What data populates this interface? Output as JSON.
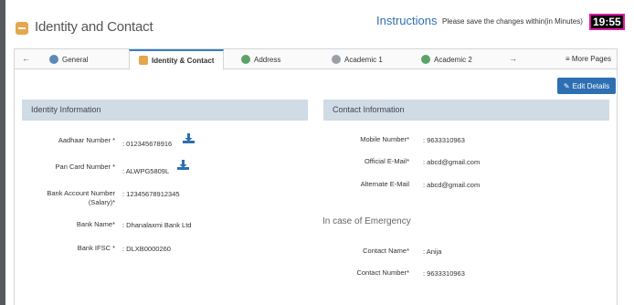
{
  "header": {
    "title": "Identity and Contact",
    "instructions": "Instructions",
    "save_note": "Please save the changes within(in Minutes)",
    "timer": "19:55"
  },
  "tabs": [
    {
      "label": "General",
      "icon": "user-icon"
    },
    {
      "label": "Identity & Contact",
      "icon": "id-card-icon",
      "active": true
    },
    {
      "label": "Address",
      "icon": "address-icon"
    },
    {
      "label": "Academic 1",
      "icon": "academic-icon"
    },
    {
      "label": "Academic 2",
      "icon": "academic-icon"
    }
  ],
  "more_pages": "≡ More Pages",
  "edit_button": "Edit Details",
  "identity": {
    "heading": "Identity Information",
    "fields": [
      {
        "label": "Aadhaar Number *",
        "value": ": 012345678916"
      },
      {
        "label": "Pan Card Number *",
        "value": ": ALWPG5809L"
      },
      {
        "label": "Bank Account Number (Salary)*",
        "value": ": 12345678912345"
      },
      {
        "label": "Bank Name*",
        "value": ": Dhanalaxmi Bank Ltd"
      },
      {
        "label": "Bank IFSC *",
        "value": ": DLXB0000260"
      }
    ]
  },
  "contact": {
    "heading": "Contact Information",
    "fields": [
      {
        "label": "Mobile Number*",
        "value": ": 9633310963"
      },
      {
        "label": "Official E-Mail*",
        "value": ": abcd@gmail.com"
      },
      {
        "label": "Alternate E-Mail",
        "value": ": abcd@gmail.com"
      }
    ],
    "emergency_heading": "In case of Emergency",
    "emergency_fields": [
      {
        "label": "Contact Name*",
        "value": ": Anija"
      },
      {
        "label": "Contact Number*",
        "value": ": 9633310963"
      }
    ]
  },
  "colors": {
    "accent": "#2d6fb3",
    "section_header": "#cfdbe5",
    "timer_border": "#e01aa6",
    "title_icon": "#e5a64c"
  }
}
